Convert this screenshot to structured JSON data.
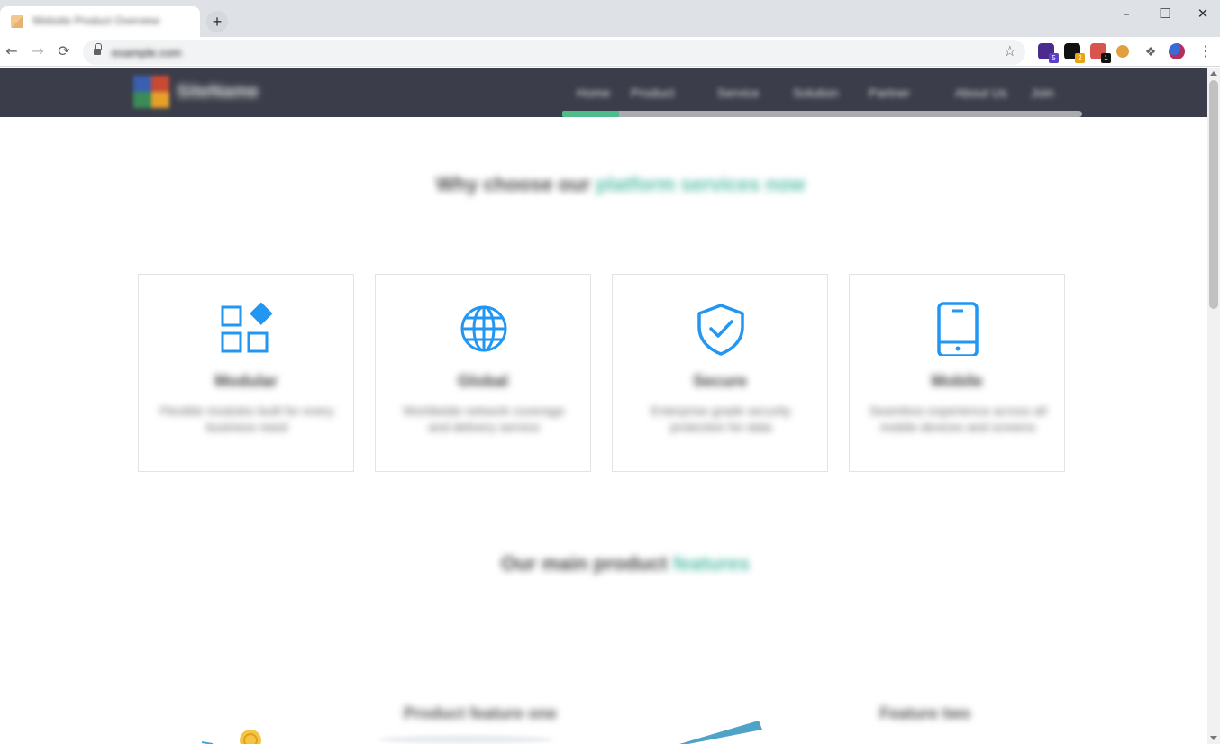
{
  "browser": {
    "tab_title": "Website Product Overview",
    "new_tab_label": "+",
    "window_controls": {
      "minimize": "–",
      "maximize": "☐",
      "close": "✕"
    },
    "nav": {
      "back": "←",
      "forward": "→",
      "reload": "⟳"
    },
    "url": "example.com",
    "bookmark_icon": "☆",
    "extensions": [
      {
        "name": "extension-1-icon",
        "badge": "5",
        "color": "#4a2c8f",
        "badge_color": "#5b3fc4"
      },
      {
        "name": "extension-2-icon",
        "badge": "2",
        "color": "#111111",
        "badge_color": "#e8a317"
      },
      {
        "name": "extension-3-icon",
        "badge": "1",
        "color": "#d9534f",
        "badge_color": "#111111"
      },
      {
        "name": "cookie-icon",
        "badge": "",
        "color": "#e0a040",
        "badge_color": ""
      },
      {
        "name": "puzzle-icon",
        "badge": "",
        "color": "#5f6368",
        "badge_color": ""
      },
      {
        "name": "profile-avatar",
        "badge": "",
        "color": "#b03060",
        "badge_color": ""
      }
    ],
    "menu_icon": "⋮"
  },
  "site": {
    "logo_text": "SiteName",
    "nav_items": [
      "Home",
      "Product",
      "Service",
      "Solution",
      "Partner",
      "About Us",
      "Join"
    ],
    "accent": "#2196f3",
    "highlight": "#58bea8",
    "section1": {
      "title_dark": "Why choose our",
      "title_highlight": "platform services now"
    },
    "cards": [
      {
        "icon": "apps-icon",
        "title": "Modular",
        "desc": "Flexible modules built for every business need"
      },
      {
        "icon": "globe-icon",
        "title": "Global",
        "desc": "Worldwide network coverage and delivery service"
      },
      {
        "icon": "shield-check-icon",
        "title": "Secure",
        "desc": "Enterprise grade security protection for data"
      },
      {
        "icon": "tablet-icon",
        "title": "Mobile",
        "desc": "Seamless experience across all mobile devices and screens"
      }
    ],
    "section2": {
      "title_dark": "Our main product",
      "title_highlight": "features"
    },
    "features": [
      {
        "caption_dark": "Product feature one",
        "caption_highlight": ""
      },
      {
        "caption_dark": "Feature two",
        "caption_highlight": ""
      }
    ]
  }
}
